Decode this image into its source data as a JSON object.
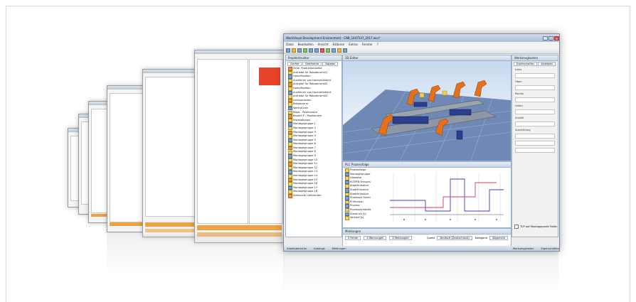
{
  "main": {
    "title": "WorkVisual Development Environment - CNB_1447547_2017.wvs*",
    "menu": [
      "Datei",
      "Bearbeiten",
      "Ansicht",
      "Editoren",
      "Extras",
      "Fenster",
      "?"
    ],
    "left_panel": {
      "header": "Projektstruktur",
      "tabs": [
        "Geräte",
        "Geometrie",
        "Dateien"
      ],
      "tree": [
        "Zelle: Produktionszelle",
        "Antriebe für Roboterarm01",
        "HomePosition",
        "Ausführen von Hochzeitsfahrt",
        "Antriebe für Roboterarm02",
        "HomePosition",
        "Ausführen von Hochzeitsfahrt",
        "Antriebe für Roboterarm03",
        "Linkssensoren",
        "Roboterarm",
        "Werkstücke",
        "Basis - Positioniere",
        "Bauteil P - Positioniere",
        "Installationen",
        "Montagegruppe 1",
        "Montagegruppe 2",
        "Montagegruppe 3",
        "Montagegruppe 4",
        "Montagegruppe 5",
        "Montagegruppe 6",
        "Montagegruppe 7",
        "Montagegruppe 8",
        "Montagegruppe 9",
        "Montagegruppe 10",
        "Montagegruppe 11",
        "Montagegruppe 12",
        "Montagegruppe 13",
        "Montagegruppe 14",
        "Montagegruppe 15",
        "Montagegruppe 16",
        "Montagegruppe 17",
        "Montagegruppe 18",
        "Elektronik Lieferanten"
      ]
    },
    "viewport": {
      "header": "3D Editor"
    },
    "chart_panel": {
      "header": "PLC Prozessfolge",
      "tree": [
        "Prozessfolge",
        "Montagegruppe",
        "Hinweise",
        "ELTERN Ereignis",
        "Stadtfrühstück",
        "Stadtfrühstück",
        "Stadtfrühstück",
        "Prozessor Folien",
        "Prüfroman",
        "Prozess",
        "Prozesssymbolik",
        "Ausdruck [s]",
        "Verkauf [s]"
      ]
    },
    "right_panel": {
      "header": "Werkzeugkasten",
      "tabs": [
        "Eigenschaften",
        "Anzeigen"
      ],
      "labels": [
        "Links",
        "Oben",
        "Rechts",
        "Unten",
        "Anzahl",
        "Ausrichtung"
      ],
      "checkbox_label": "TCP auf Montagepunkt Folien"
    },
    "bottom_panel": {
      "header": "Meldungen",
      "tabs": [
        "0 Fehler",
        "0 Warnungen",
        "0 Meldungen"
      ],
      "filters": [
        "Quelle",
        "Deutsch (Deutschland)",
        "Kategorie",
        "Allgemein"
      ]
    },
    "status": [
      "Arbeitsbereiche",
      "Katalogs",
      "Meldungen",
      "Werkzeugkasten",
      "Eigenschaften"
    ]
  },
  "colors": {
    "accent_orange": "#f0a040",
    "selection_red": "#e8432b",
    "title_blue": "#a9bdd6"
  }
}
